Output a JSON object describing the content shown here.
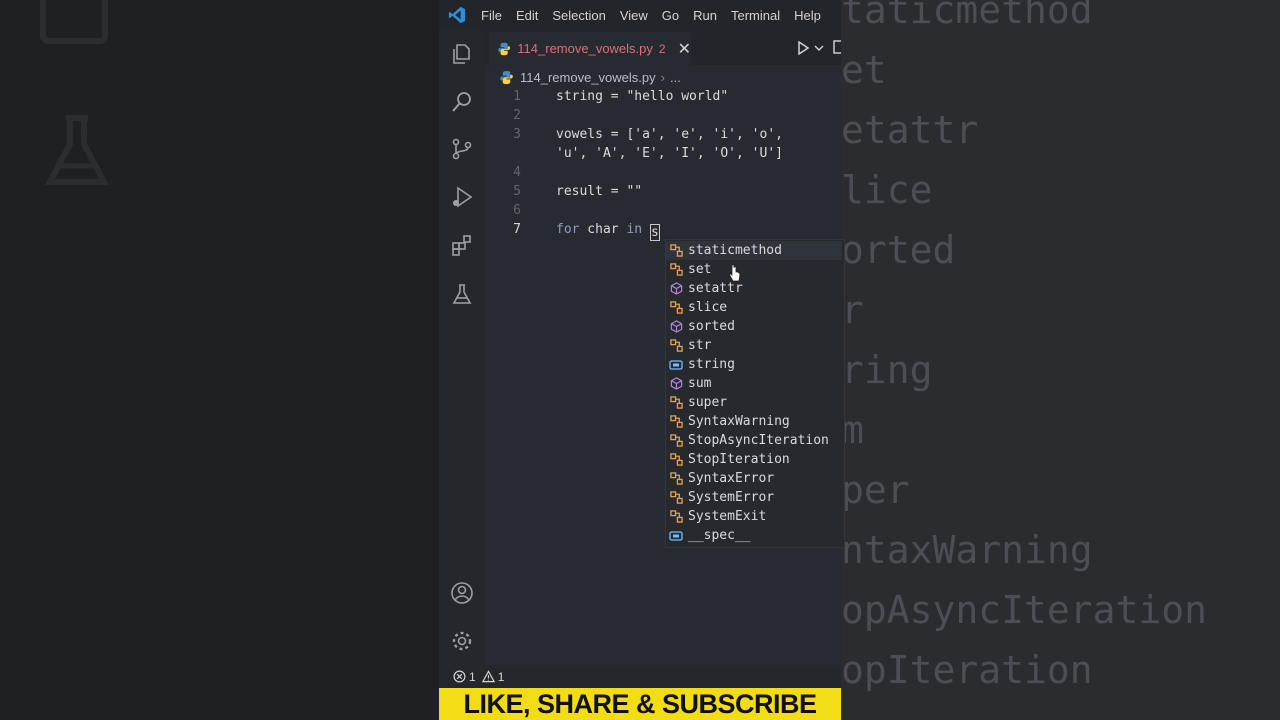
{
  "menu": [
    "File",
    "Edit",
    "Selection",
    "View",
    "Go",
    "Run",
    "Terminal",
    "Help"
  ],
  "tab": {
    "filename": "114_remove_vowels.py",
    "problems": "2"
  },
  "breadcrumb": {
    "file": "114_remove_vowels.py",
    "more": "..."
  },
  "code_lines": [
    {
      "num": "1",
      "text": "string = \"hello world\""
    },
    {
      "num": "2",
      "text": ""
    },
    {
      "num": "3",
      "text": "vowels = ['a', 'e', 'i', 'o',",
      "cont": "'u', 'A', 'E', 'I', 'O', 'U']"
    },
    {
      "num": "4",
      "text": ""
    },
    {
      "num": "5",
      "text": "result = \"\""
    },
    {
      "num": "6",
      "text": ""
    },
    {
      "num": "7",
      "kw1": "for",
      "mid": " char ",
      "kw2": "in",
      "typed": "s"
    }
  ],
  "suggestions": [
    {
      "label": "staticmethod",
      "icon": "class-icon"
    },
    {
      "label": "set",
      "icon": "class-icon"
    },
    {
      "label": "setattr",
      "icon": "function-icon"
    },
    {
      "label": "slice",
      "icon": "class-icon"
    },
    {
      "label": "sorted",
      "icon": "function-icon"
    },
    {
      "label": "str",
      "icon": "class-icon"
    },
    {
      "label": "string",
      "icon": "variable-icon"
    },
    {
      "label": "sum",
      "icon": "function-icon"
    },
    {
      "label": "super",
      "icon": "class-icon"
    },
    {
      "label": "SyntaxWarning",
      "icon": "class-icon"
    },
    {
      "label": "StopAsyncIteration",
      "icon": "class-icon"
    },
    {
      "label": "StopIteration",
      "icon": "class-icon"
    },
    {
      "label": "SyntaxError",
      "icon": "class-icon"
    },
    {
      "label": "SystemError",
      "icon": "class-icon"
    },
    {
      "label": "SystemExit",
      "icon": "class-icon"
    },
    {
      "label": "__spec__",
      "icon": "variable-icon"
    }
  ],
  "status": {
    "errors": "1",
    "warnings": "1"
  },
  "banner": "LIKE, SHARE & SUBSCRIBE",
  "background_echo": [
    "taticmethod",
    "et",
    "etattr",
    "lice",
    "orted",
    "r",
    "ring",
    "m",
    "per",
    "ntaxWarning",
    "opAsyncIteration",
    "opIteration"
  ],
  "colors": {
    "accent_yellow": "#f2dc14",
    "tab_error": "#e06c75",
    "class_icon": "#e5a445",
    "function_icon": "#b180d7",
    "variable_icon": "#75beff"
  }
}
